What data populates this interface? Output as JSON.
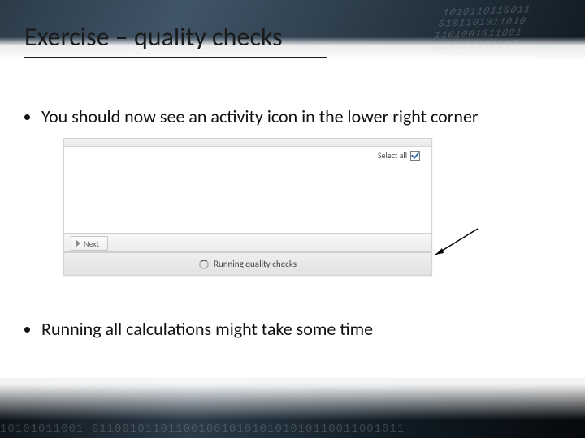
{
  "title": "Exercise – quality checks",
  "bullets": {
    "one": "You should now see an activity icon in the lower right corner",
    "two": "Running all calculations might take some time"
  },
  "shot": {
    "select_all_label": "Select all",
    "next_label": "Next",
    "status_text": "Running quality checks"
  },
  "decor": {
    "binary_top": "1010110110011\n0101101011010\n1101001011001\n0100110101100",
    "binary_bottom": "10101011001 01100101101100100101010101010110011001011"
  }
}
